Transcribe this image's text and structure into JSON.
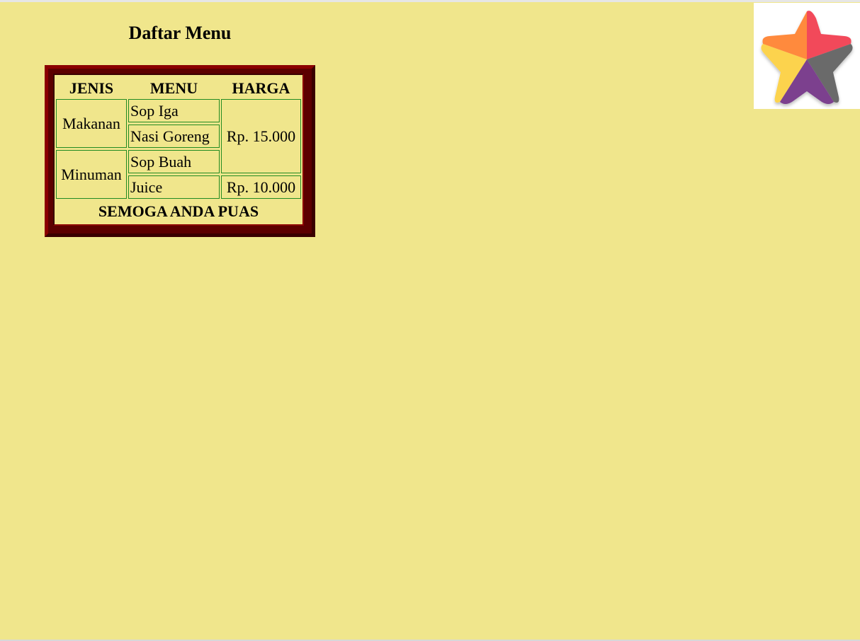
{
  "page": {
    "title": "Daftar Menu"
  },
  "menu_table": {
    "headers": [
      "JENIS",
      "MENU",
      "HARGA"
    ],
    "groups": [
      {
        "jenis": "Makanan",
        "items": [
          "Sop Iga",
          "Nasi Goreng"
        ]
      },
      {
        "jenis": "Minuman",
        "items": [
          "Sop Buah",
          "Juice"
        ]
      }
    ],
    "prices": [
      "Rp. 15.000",
      "Rp. 10.000"
    ],
    "footer": "SEMOGA ANDA PUAS"
  },
  "logo": {
    "icon": "star-logo-icon",
    "colors": {
      "top_left": "#ff8a3d",
      "top_right": "#f24a5a",
      "left": "#fcd34d",
      "right": "#6b6b6b",
      "bottom": "#7b3f8e"
    }
  },
  "colors": {
    "background": "#f0e68c",
    "frame": "#5c0000",
    "cell_border": "#228b22"
  }
}
